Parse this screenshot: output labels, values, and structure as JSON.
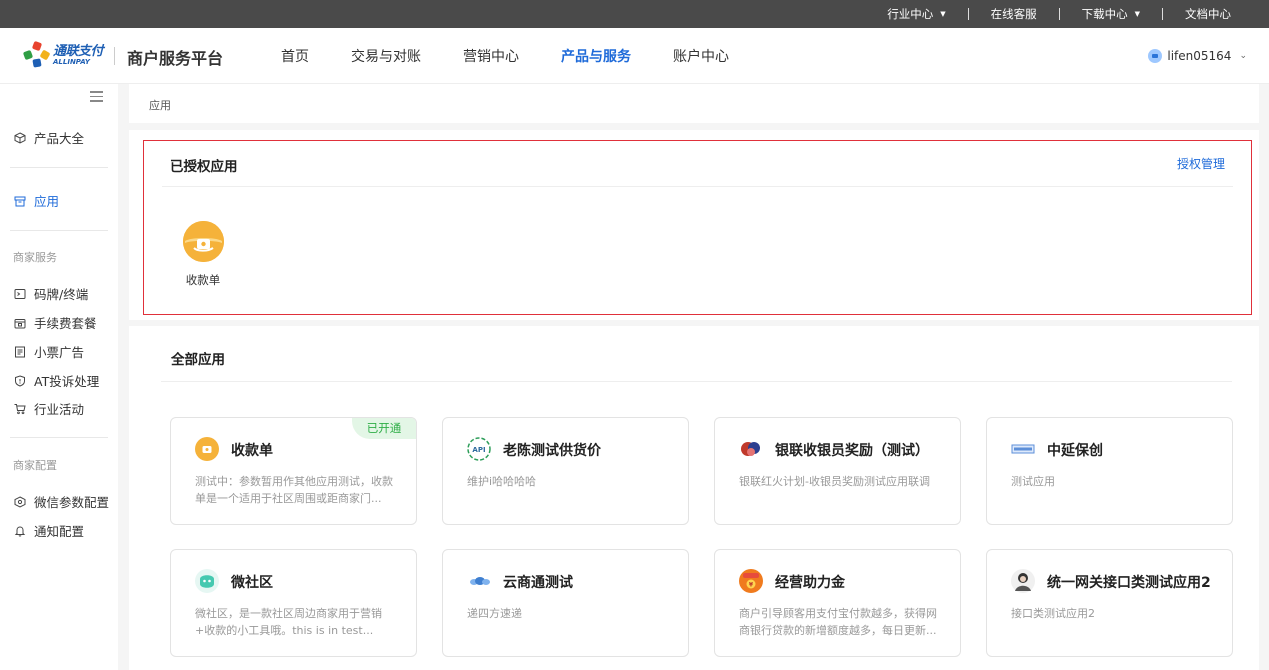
{
  "topbar": {
    "items": [
      {
        "label": "行业中心",
        "has_caret": true
      },
      {
        "label": "在线客服",
        "has_caret": false
      },
      {
        "label": "下载中心",
        "has_caret": true
      },
      {
        "label": "文档中心",
        "has_caret": false
      }
    ]
  },
  "header": {
    "logo_cn": "通联支付",
    "logo_en": "ALLINPAY",
    "platform_title": "商户服务平台",
    "nav": [
      "首页",
      "交易与对账",
      "营销中心",
      "产品与服务",
      "账户中心"
    ],
    "active_nav": "产品与服务",
    "username": "lifen05164"
  },
  "sidebar": {
    "items_top": [
      {
        "label": "产品大全",
        "icon": "cube-icon"
      },
      {
        "label": "应用",
        "icon": "box-icon"
      }
    ],
    "group_merchant_service": "商家服务",
    "merchant_service_items": [
      {
        "label": "码牌/终端",
        "icon": "terminal-icon"
      },
      {
        "label": "手续费套餐",
        "icon": "package-icon"
      },
      {
        "label": "小票广告",
        "icon": "receipt-icon"
      },
      {
        "label": "AT投诉处理",
        "icon": "shield-icon"
      },
      {
        "label": "行业活动",
        "icon": "cart-icon"
      }
    ],
    "group_merchant_config": "商家配置",
    "merchant_config_items": [
      {
        "label": "微信参数配置",
        "icon": "settings-cube-icon"
      },
      {
        "label": "通知配置",
        "icon": "bell-icon"
      }
    ]
  },
  "breadcrumb": "应用",
  "authorized": {
    "title": "已授权应用",
    "manage_link": "授权管理",
    "apps": [
      {
        "label": "收款单"
      }
    ]
  },
  "all_apps": {
    "title": "全部应用",
    "cards": [
      {
        "title": "收款单",
        "desc": "测试中：参数暂用作其他应用测试，收款单是一个适用于社区周围或距商家门...",
        "badge": "已开通",
        "icon_color": "#f5b23a"
      },
      {
        "title": "老陈测试供货价",
        "desc": "维护i哈哈哈哈",
        "badge": "",
        "icon_color": "#2e9e5a"
      },
      {
        "title": "银联收银员奖励（测试）",
        "desc": "银联红火计划-收银员奖励测试应用联调",
        "badge": "",
        "icon_color": "#c0392b"
      },
      {
        "title": "中延保创",
        "desc": "测试应用",
        "badge": "",
        "icon_color": "#5d8fd8"
      },
      {
        "title": "微社区",
        "desc": "微社区，是一款社区周边商家用于营销+收款的小工具哦。this is in test...",
        "badge": "",
        "icon_color": "#46c9b0"
      },
      {
        "title": "云商通测试",
        "desc": "递四方速递",
        "badge": "",
        "icon_color": "#3f7fd0"
      },
      {
        "title": "经营助力金",
        "desc": "商户引导顾客用支付宝付款越多，获得网商银行贷款的新增额度越多，每日更新...",
        "badge": "",
        "icon_color": "#f07b1e"
      },
      {
        "title": "统一网关接口类测试应用2",
        "desc": "接口类测试应用2",
        "badge": "",
        "icon_color": "#444444"
      }
    ]
  }
}
